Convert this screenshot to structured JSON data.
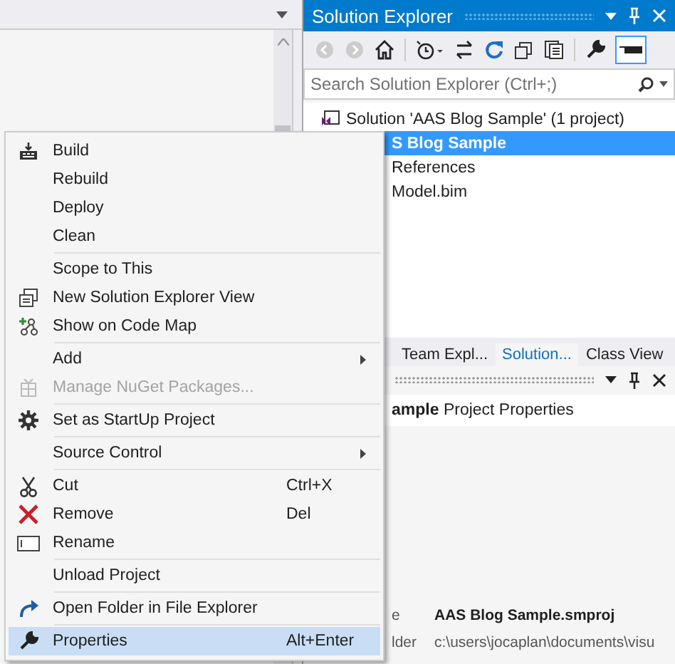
{
  "solution_explorer": {
    "title": "Solution Explorer",
    "search": {
      "placeholder": "Search Solution Explorer (Ctrl+;)"
    },
    "tree": [
      {
        "label": "Solution 'AAS Blog Sample' (1 project)",
        "selected": false,
        "children": [
          {
            "label": "S Blog Sample",
            "selected": true,
            "children": [
              {
                "label": "References",
                "selected": false
              },
              {
                "label": "Model.bim",
                "selected": false
              }
            ]
          }
        ]
      }
    ]
  },
  "tabs": [
    {
      "label": "Team Expl...",
      "selected": false
    },
    {
      "label": "Solution...",
      "selected": true
    },
    {
      "label": "Class View",
      "selected": false
    }
  ],
  "properties": {
    "object": "**ample** Project Properties",
    "rows": [
      {
        "name": "e",
        "value": "AAS Blog Sample.smproj",
        "bold": true
      },
      {
        "name": "lder",
        "value": "c:\\users\\jocaplan\\documents\\visu",
        "bold": false
      }
    ]
  },
  "context_menu": [
    {
      "items": [
        {
          "label": "Build",
          "disabled": false,
          "selected": false
        },
        {
          "label": "Rebuild",
          "disabled": false,
          "selected": false
        },
        {
          "label": "Deploy",
          "disabled": false,
          "selected": false
        },
        {
          "label": "Clean",
          "disabled": false,
          "selected": false
        }
      ]
    },
    {
      "items": [
        {
          "label": "Scope to This",
          "disabled": false,
          "selected": false
        },
        {
          "label": "New Solution Explorer View",
          "disabled": false,
          "selected": false
        },
        {
          "label": "Show on Code Map",
          "disabled": false,
          "selected": false
        }
      ]
    },
    {
      "items": [
        {
          "label": "Add",
          "submenu": true,
          "disabled": false,
          "selected": false
        },
        {
          "label": "Manage NuGet Packages...",
          "disabled": true,
          "selected": false
        }
      ]
    },
    {
      "items": [
        {
          "label": "Set as StartUp Project",
          "disabled": false,
          "selected": false
        }
      ]
    },
    {
      "items": [
        {
          "label": "Source Control",
          "submenu": true,
          "disabled": false,
          "selected": false
        }
      ]
    },
    {
      "items": [
        {
          "label": "Cut",
          "shortcut": "Ctrl+X",
          "disabled": false,
          "selected": false
        },
        {
          "label": "Remove",
          "shortcut": "Del",
          "disabled": false,
          "selected": false
        },
        {
          "label": "Rename",
          "disabled": false,
          "selected": false
        }
      ]
    },
    {
      "items": [
        {
          "label": "Unload Project",
          "disabled": false,
          "selected": false
        }
      ]
    },
    {
      "items": [
        {
          "label": "Open Folder in File Explorer",
          "disabled": false,
          "selected": false
        }
      ]
    },
    {
      "items": [
        {
          "label": "Properties",
          "shortcut": "Alt+Enter",
          "disabled": false,
          "selected": true
        }
      ]
    }
  ]
}
